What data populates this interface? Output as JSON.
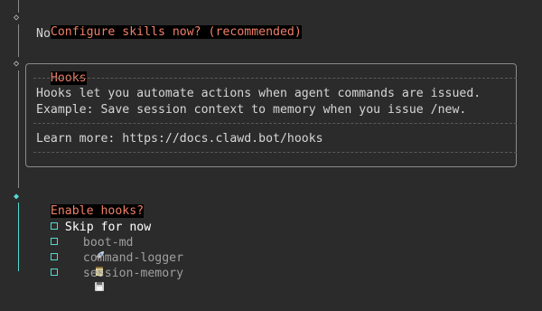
{
  "terminal": {
    "prompt_skills": "Configure skills now? (recommended)",
    "answer_skills": "No",
    "hooks_title": "Hooks",
    "hooks_text_1": "Hooks let you automate actions when agent commands are issued.",
    "hooks_text_2": "Example: Save session context to memory when you issue /new.",
    "hooks_text_3": "Learn more: https://docs.clawd.bot/hooks",
    "prompt_enable_hooks": "Enable hooks?",
    "options": [
      {
        "label": "Skip for now",
        "emoji": "none"
      },
      {
        "label": "boot-md",
        "emoji": "rocket-icon"
      },
      {
        "label": "command-logger",
        "emoji": "notepad-icon"
      },
      {
        "label": "session-memory",
        "emoji": "floppy-disk-icon"
      }
    ]
  },
  "colors": {
    "background": "#2b2b2b",
    "title": "#f07f68",
    "accent": "#56d9cf",
    "text": "#d6d6d6"
  }
}
